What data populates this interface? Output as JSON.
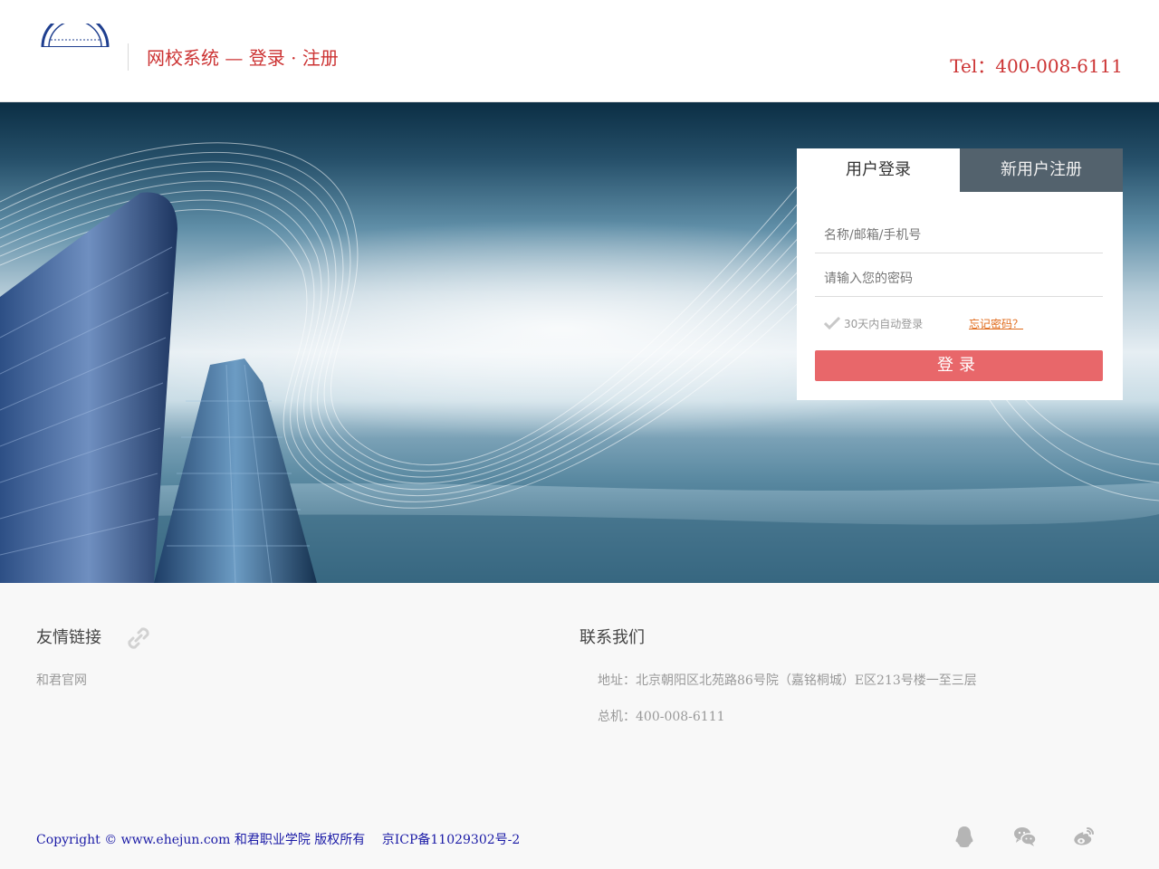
{
  "header": {
    "title": "网校系统 — 登录 · 注册",
    "tel": "Tel：400-008-6111"
  },
  "login": {
    "tab_login": "用户登录",
    "tab_register": "新用户注册",
    "username_placeholder": "名称/邮箱/手机号",
    "password_placeholder": "请输入您的密码",
    "remember_label": "30天内自动登录",
    "forgot_label": "忘记密码？",
    "submit_label": "登录"
  },
  "footer": {
    "links_title": "友情链接",
    "links": [
      "和君官网"
    ],
    "contact_title": "联系我们",
    "address": "地址：北京朝阳区北苑路86号院（嘉铭桐城）E区213号楼一至三层",
    "phone": "总机：400-008-6111",
    "copyright": "Copyright © www.ehejun.com 和君职业学院 版权所有　 京ICP备11029302号-2"
  },
  "icons": {
    "logo": "school-logo-icon",
    "link": "link-icon",
    "check": "check-icon",
    "qq": "qq-icon",
    "wechat": "wechat-icon",
    "weibo": "weibo-icon"
  },
  "colors": {
    "accent": "#cc3333",
    "button": "#e8676a",
    "forgot_link": "#e06a1a",
    "copyright": "#1a1aa6"
  }
}
